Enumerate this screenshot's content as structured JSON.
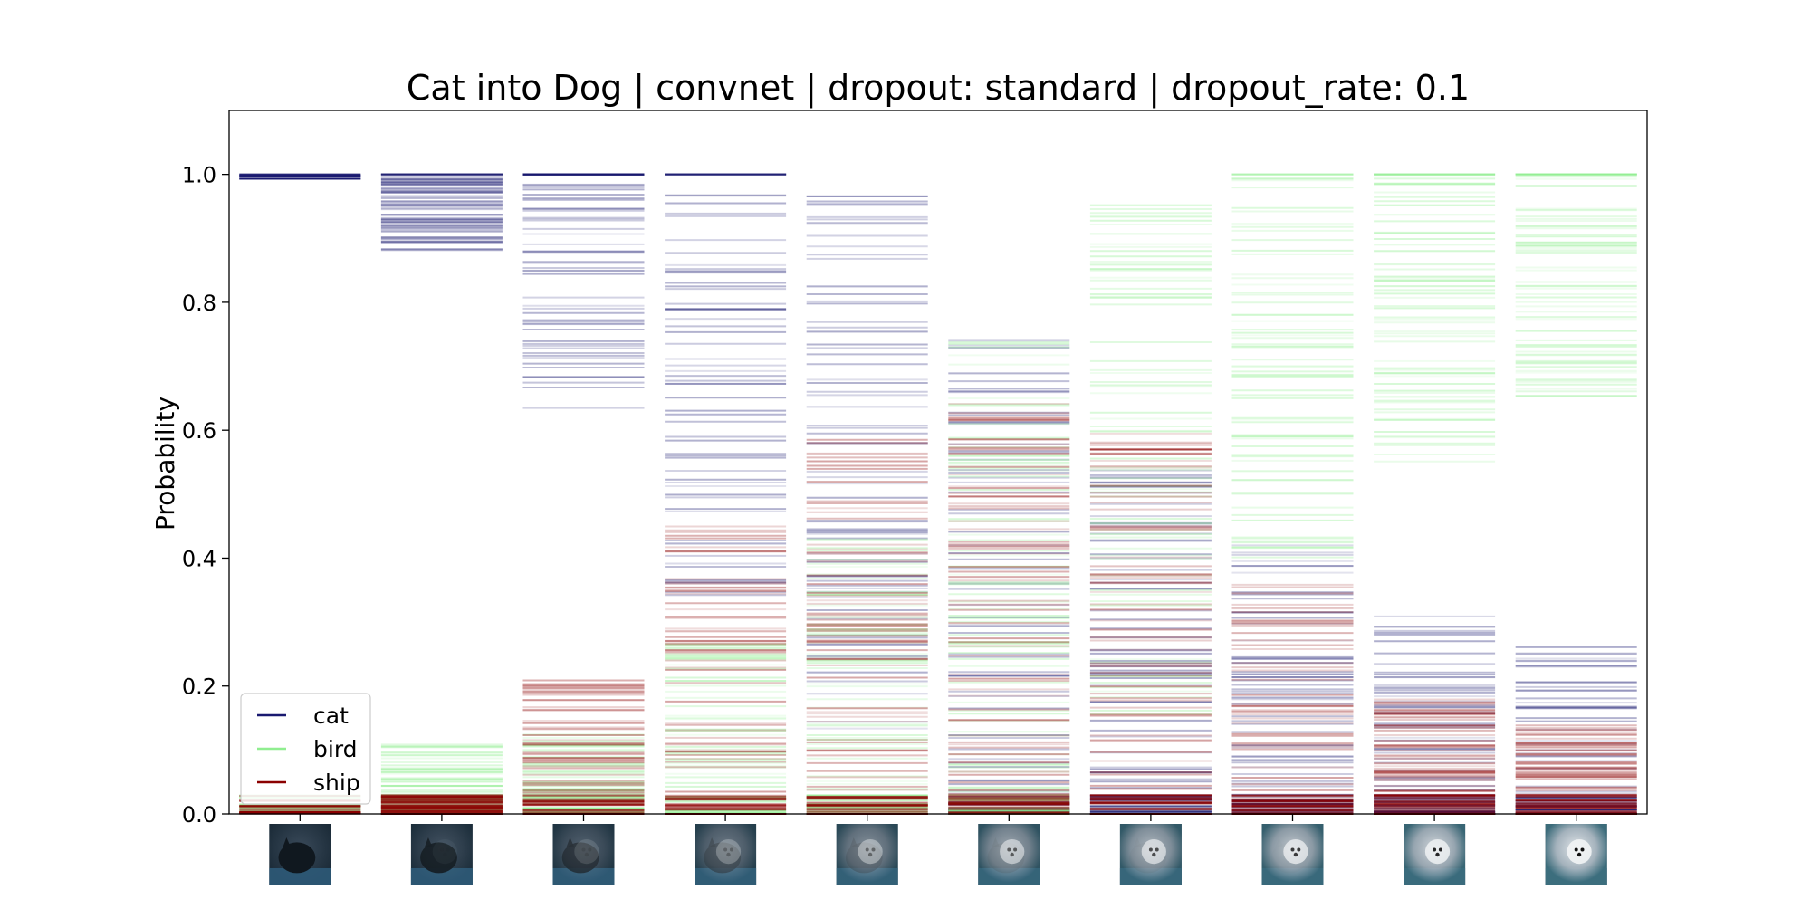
{
  "chart_data": {
    "type": "line",
    "title": "Cat into Dog | convnet | dropout: standard | dropout_rate: 0.1",
    "xlabel": "",
    "ylabel": "Probability",
    "ylim": [
      -0.0,
      1.1
    ],
    "yticks": [
      0.0,
      0.2,
      0.4,
      0.6,
      0.8,
      1.0
    ],
    "ytick_labels": [
      "0.0",
      "0.2",
      "0.4",
      "0.6",
      "0.8",
      "1.0"
    ],
    "steps": 10,
    "grid": false,
    "legend": {
      "placement": "lower-left",
      "entries": [
        {
          "label": "cat",
          "color": "#191970"
        },
        {
          "label": "bird",
          "color": "#90ee90"
        },
        {
          "label": "ship",
          "color": "#8b0000"
        }
      ]
    },
    "series": [
      {
        "name": "cat",
        "color": "#191970",
        "mean": [
          0.995,
          0.96,
          0.88,
          0.72,
          0.55,
          0.35,
          0.22,
          0.14,
          0.09,
          0.07
        ],
        "spread": [
          0.01,
          0.08,
          0.25,
          0.38,
          0.42,
          0.4,
          0.32,
          0.28,
          0.22,
          0.2
        ]
      },
      {
        "name": "bird",
        "color": "#90ee90",
        "mean": [
          0.002,
          0.01,
          0.03,
          0.08,
          0.15,
          0.35,
          0.55,
          0.72,
          0.8,
          0.85
        ],
        "spread": [
          0.002,
          0.1,
          0.1,
          0.2,
          0.3,
          0.4,
          0.42,
          0.32,
          0.25,
          0.2
        ]
      },
      {
        "name": "ship",
        "color": "#8b0000",
        "mean": [
          0.002,
          0.01,
          0.06,
          0.15,
          0.25,
          0.3,
          0.25,
          0.12,
          0.06,
          0.04
        ],
        "spread": [
          0.002,
          0.02,
          0.15,
          0.3,
          0.35,
          0.35,
          0.35,
          0.25,
          0.12,
          0.1
        ]
      }
    ],
    "thumbnails": [
      {
        "morph": 0.0
      },
      {
        "morph": 0.05
      },
      {
        "morph": 0.15
      },
      {
        "morph": 0.3
      },
      {
        "morph": 0.45
      },
      {
        "morph": 0.6
      },
      {
        "morph": 0.7
      },
      {
        "morph": 0.8
      },
      {
        "morph": 0.9
      },
      {
        "morph": 1.0
      }
    ]
  }
}
